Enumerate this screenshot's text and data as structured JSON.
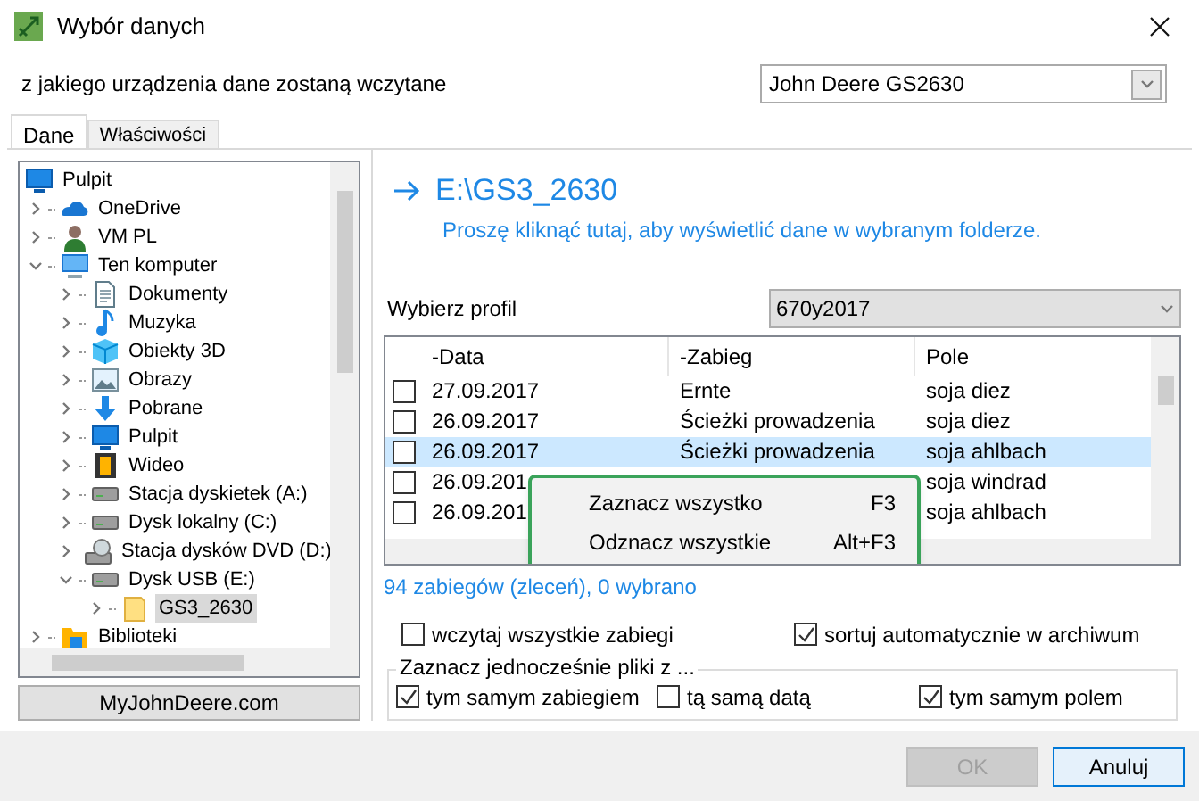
{
  "window": {
    "title": "Wybór danych"
  },
  "device": {
    "label": "z jakiego urządzenia dane zostaną wczytane",
    "value": "John Deere GS2630"
  },
  "tabs": [
    {
      "label": "Dane",
      "selected": true
    },
    {
      "label": "Właściwości",
      "selected": false
    }
  ],
  "tree": [
    {
      "label": "Pulpit",
      "kind": "desktop",
      "selected": false,
      "children": [
        {
          "label": "OneDrive",
          "kind": "cloud",
          "expanded": false,
          "selected": false
        },
        {
          "label": "VM PL",
          "kind": "person",
          "expanded": false,
          "selected": false
        },
        {
          "label": "Ten komputer",
          "kind": "computer",
          "expanded": true,
          "selected": false,
          "children": [
            {
              "label": "Dokumenty",
              "kind": "document",
              "expanded": false,
              "selected": false
            },
            {
              "label": "Muzyka",
              "kind": "music",
              "expanded": false,
              "selected": false
            },
            {
              "label": "Obiekty 3D",
              "kind": "cube",
              "expanded": false,
              "selected": false
            },
            {
              "label": "Obrazy",
              "kind": "image",
              "expanded": false,
              "selected": false
            },
            {
              "label": "Pobrane",
              "kind": "download",
              "expanded": false,
              "selected": false
            },
            {
              "label": "Pulpit",
              "kind": "desktop",
              "expanded": false,
              "selected": false
            },
            {
              "label": "Wideo",
              "kind": "film",
              "expanded": false,
              "selected": false
            },
            {
              "label": "Stacja dyskietek (A:)",
              "kind": "drive",
              "expanded": false,
              "selected": false
            },
            {
              "label": "Dysk lokalny (C:)",
              "kind": "drive",
              "expanded": false,
              "selected": false
            },
            {
              "label": "Stacja dysków DVD (D:)",
              "kind": "disc",
              "expanded": false,
              "selected": false
            },
            {
              "label": "Dysk USB (E:)",
              "kind": "drive",
              "expanded": true,
              "selected": false,
              "children": [
                {
                  "label": "GS3_2630",
                  "kind": "folder",
                  "expanded": false,
                  "selected": true
                }
              ]
            }
          ]
        },
        {
          "label": "Biblioteki",
          "kind": "library",
          "expanded": false,
          "selected": false
        }
      ]
    }
  ],
  "web_button": "MyJohnDeere.com",
  "path": {
    "title": "E:\\GS3_2630",
    "hint": "Proszę kliknąć tutaj, aby wyświetlić dane w wybranym folderze."
  },
  "profile": {
    "label": "Wybierz profil",
    "value": "670y2017"
  },
  "table": {
    "columns": [
      "-Data",
      "-Zabieg",
      "Pole"
    ],
    "rows": [
      {
        "checked": false,
        "selected": false,
        "cells": [
          "27.09.2017",
          "Ernte",
          "soja diez"
        ]
      },
      {
        "checked": false,
        "selected": false,
        "cells": [
          "26.09.2017",
          "Ścieżki prowadzenia",
          "soja diez"
        ]
      },
      {
        "checked": false,
        "selected": true,
        "cells": [
          "26.09.2017",
          "Ścieżki prowadzenia",
          "soja ahlbach"
        ]
      },
      {
        "checked": false,
        "selected": false,
        "cells": [
          "26.09.201",
          "",
          "soja windrad"
        ]
      },
      {
        "checked": false,
        "selected": false,
        "cells": [
          "26.09.201",
          "",
          "soja ahlbach"
        ]
      }
    ]
  },
  "context_menu": [
    {
      "label": "Zaznacz wszystko",
      "shortcut": "F3"
    },
    {
      "label": "Odznacz wszystkie",
      "shortcut": "Alt+F3"
    }
  ],
  "status": "94 zabiegów (zleceń), 0 wybrano",
  "options": [
    {
      "label": "wczytaj wszystkie zabiegi",
      "checked": false
    },
    {
      "label": "sortuj automatycznie w archiwum",
      "checked": true
    }
  ],
  "group": {
    "title": "Zaznacz jednocześnie pliki z ...",
    "options": [
      {
        "label": "tym samym zabiegiem",
        "checked": true
      },
      {
        "label": "tą samą datą",
        "checked": false
      },
      {
        "label": "tym samym polem",
        "checked": true
      }
    ]
  },
  "buttons": [
    {
      "label": "OK",
      "disabled": true
    },
    {
      "label": "Anuluj",
      "disabled": false
    }
  ]
}
